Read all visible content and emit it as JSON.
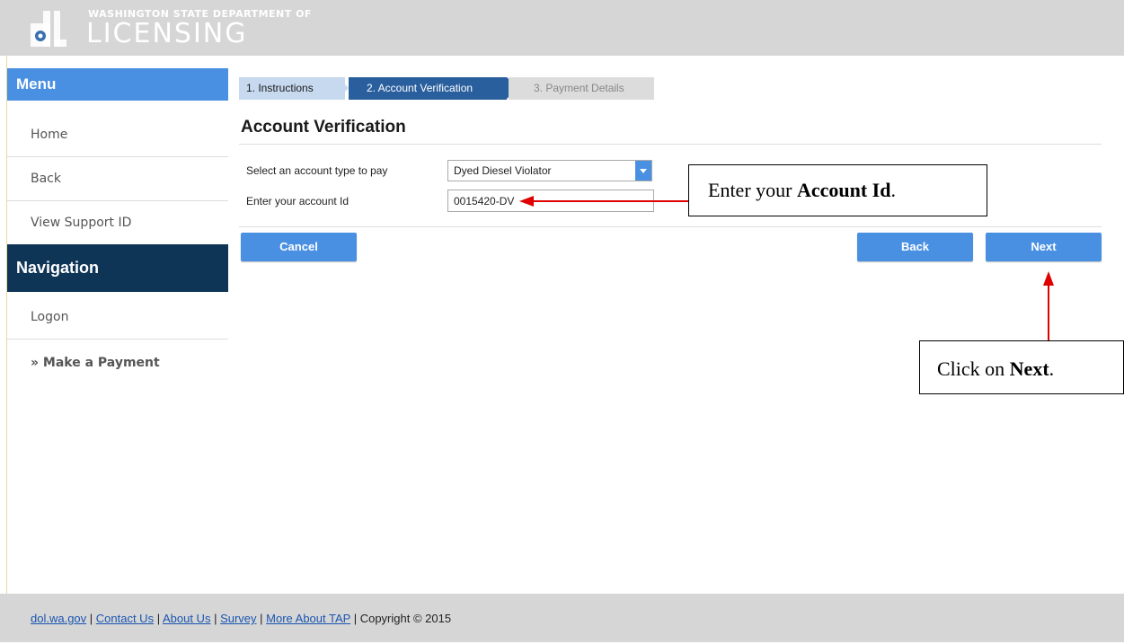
{
  "header": {
    "agency_line": "WASHINGTON STATE DEPARTMENT OF",
    "agency_name": "LICENSING",
    "logo_text": "dol"
  },
  "sidebar": {
    "menu_heading": "Menu",
    "menu_items": [
      "Home",
      "Back",
      "View Support ID"
    ],
    "nav_heading": "Navigation",
    "nav_items": [
      "Logon",
      "» Make a Payment"
    ]
  },
  "steps": [
    {
      "label": "1. Instructions",
      "state": "completed"
    },
    {
      "label": "2. Account Verification",
      "state": "active"
    },
    {
      "label": "3. Payment Details",
      "state": "upcoming"
    }
  ],
  "form": {
    "title": "Account Verification",
    "account_type_label": "Select an account type to pay",
    "account_type_value": "Dyed Diesel Violator",
    "account_id_label": "Enter your account Id",
    "account_id_value": "0015420-DV"
  },
  "buttons": {
    "cancel": "Cancel",
    "back": "Back",
    "next": "Next"
  },
  "callouts": {
    "account_id_prefix": "Enter your ",
    "account_id_bold": "Account Id",
    "account_id_suffix": ".",
    "next_prefix": "Click on ",
    "next_bold": "Next",
    "next_suffix": "."
  },
  "footer": {
    "links": [
      "dol.wa.gov",
      "Contact Us",
      "About Us",
      "Survey",
      "More About TAP"
    ],
    "copyright": "Copyright © 2015"
  },
  "colors": {
    "accent_blue": "#4a90e2",
    "nav_dark": "#0e3456",
    "step_active": "#2a5f9e",
    "annotation_red": "#e00000"
  }
}
